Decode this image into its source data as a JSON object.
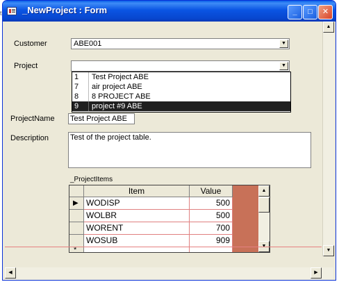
{
  "window": {
    "title": "_NewProject : Form",
    "minimize_glyph": "_",
    "maximize_glyph": "□",
    "close_glyph": "✕"
  },
  "form": {
    "customer_label": "Customer",
    "customer_value": "ABE001",
    "project_label": "Project",
    "project_value": "",
    "project_dropdown": [
      {
        "id": "1",
        "name": "Test Project ABE"
      },
      {
        "id": "7",
        "name": "air project ABE"
      },
      {
        "id": "8",
        "name": "8 PROJECT ABE"
      },
      {
        "id": "9",
        "name": "project #9 ABE"
      }
    ],
    "project_selected_index": 3,
    "projectname_label": "ProjectName",
    "projectname_value": "Test Project ABE",
    "description_label": "Description",
    "description_value": "Test of the project table."
  },
  "subform": {
    "label": "_ProjectItems",
    "columns": [
      "Item",
      "Value"
    ],
    "rows": [
      {
        "item": "WODISP",
        "value": "500"
      },
      {
        "item": "WOLBR",
        "value": "500"
      },
      {
        "item": "WORENT",
        "value": "700"
      },
      {
        "item": "WOSUB",
        "value": "909"
      }
    ],
    "current_row_marker": "▶",
    "new_row_marker": "*"
  },
  "scroll": {
    "up": "▲",
    "down": "▼",
    "left": "◀",
    "right": "▶"
  },
  "colors": {
    "title_bar": "#0a54e3",
    "form_background": "#ece9d8",
    "selected_row": "#1f1f1f",
    "grid_blank_area": "#c87158"
  }
}
